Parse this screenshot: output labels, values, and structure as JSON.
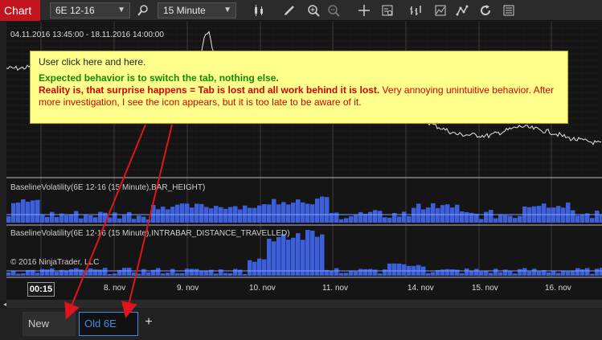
{
  "toolbar": {
    "chart_label": "Chart",
    "instrument": "6E 12-16",
    "interval": "15 Minute",
    "icons": [
      "search-icon",
      "candlestick-icon",
      "pencil-icon",
      "zoom-in-icon",
      "zoom-out-icon",
      "crosshair-icon",
      "data-box-icon",
      "bar-type-icon",
      "indicators-icon",
      "strategies-icon",
      "refresh-icon",
      "properties-icon"
    ]
  },
  "chart": {
    "date_range": "04.11.2016 13:45:00 - 18.11.2016 14:00:00",
    "panel1_label": "BaselineVolatility(6E 12-16 (15 Minute),BAR_HEIGHT)",
    "panel2_label": "BaselineVolatility(6E 12-16 (15 Minute),INTRABAR_DISTANCE_TRAVELLED)",
    "copyright": "© 2016 NinjaTrader, LLC",
    "time_box": "00:15",
    "x_labels": [
      "8. nov",
      "9. nov",
      "10. nov",
      "11. nov",
      "14. nov",
      "15. nov",
      "16. nov"
    ],
    "bar_color": "#3d5fdc"
  },
  "tabs": {
    "new_label": "New",
    "old_label": "Old 6E",
    "add_label": "+"
  },
  "callout": {
    "line1": "User click here and here.",
    "line2": "Expected behavior is to switch the tab, nothing else.",
    "line3_prefix": "Reality is",
    "line3_bold": ", that surprise happens = Tab is lost and all work behind it is lost.",
    "line3_rest": " Very annoying unintuitive behavior. After more investigation, I see the icon appears, but it is too late to be aware of it."
  }
}
